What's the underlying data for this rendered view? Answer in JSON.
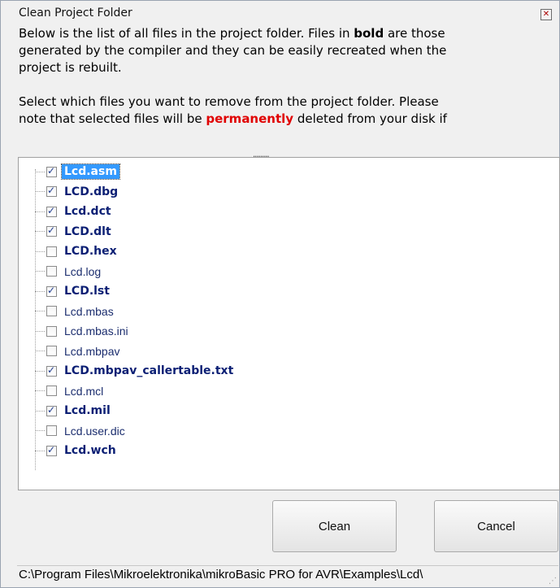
{
  "window": {
    "title": "Clean Project Folder"
  },
  "description": {
    "p1_line1_a": "Below is the list of all files in the project folder. Files in ",
    "p1_line1_bold": "bold",
    "p1_line1_b": " are those",
    "p1_line2": "generated by the compiler and they can be easily recreated when the",
    "p1_line3": "project is rebuilt.",
    "p2_line1": "Select which files you want to remove from the project folder. Please",
    "p2_line2_a": "note that selected files will be ",
    "p2_line2_red": "permanently",
    "p2_line2_b": " deleted from your disk if"
  },
  "files": [
    {
      "name": "Lcd.asm",
      "checked": true,
      "bold": true,
      "selected": true
    },
    {
      "name": "LCD.dbg",
      "checked": true,
      "bold": true
    },
    {
      "name": "Lcd.dct",
      "checked": true,
      "bold": true
    },
    {
      "name": "LCD.dlt",
      "checked": true,
      "bold": true
    },
    {
      "name": "LCD.hex",
      "checked": false,
      "bold": true
    },
    {
      "name": "Lcd.log",
      "checked": false,
      "bold": false
    },
    {
      "name": "LCD.lst",
      "checked": true,
      "bold": true
    },
    {
      "name": "Lcd.mbas",
      "checked": false,
      "bold": false
    },
    {
      "name": "Lcd.mbas.ini",
      "checked": false,
      "bold": false
    },
    {
      "name": "Lcd.mbpav",
      "checked": false,
      "bold": false
    },
    {
      "name": "LCD.mbpav_callertable.txt",
      "checked": true,
      "bold": true
    },
    {
      "name": "Lcd.mcl",
      "checked": false,
      "bold": false
    },
    {
      "name": "Lcd.mil",
      "checked": true,
      "bold": true
    },
    {
      "name": "Lcd.user.dic",
      "checked": false,
      "bold": false
    },
    {
      "name": "Lcd.wch",
      "checked": true,
      "bold": true
    }
  ],
  "buttons": {
    "clean": "Clean",
    "cancel": "Cancel"
  },
  "status": {
    "path": "C:\\Program Files\\Mikroelektronika\\mikroBasic PRO for AVR\\Examples\\Lcd\\"
  },
  "colors": {
    "selection": "#3399ff",
    "bold_text": "#0b1f74",
    "warning": "#e00000"
  }
}
